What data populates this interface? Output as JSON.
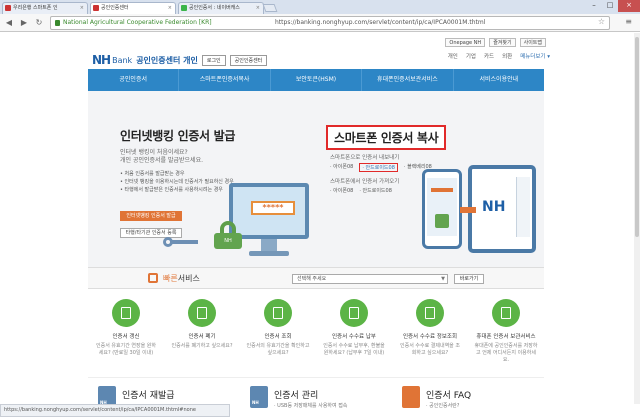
{
  "browser": {
    "tabs": [
      {
        "label": "우리은행 스마트폰 인",
        "active": false
      },
      {
        "label": "공인인증센터",
        "active": true
      },
      {
        "label": "공인인증서 : 네이버캐스",
        "active": false
      }
    ],
    "ev_label": "National Agricultural Cooperative Federation [KR]",
    "url": "https://banking.nonghyup.com/servlet/content/ip/ca/IPCA0001M.thtml",
    "status_url": "https://banking.nonghyup.com/servlet/content/ip/ca/IPCA0001M.thtml#none"
  },
  "header": {
    "logo_nh": "NH",
    "logo_bank": "Bank",
    "logo_title": "공인인증센터 개인",
    "login_btn": "로그인",
    "center_btn": "공인인증센터",
    "onepage": "Onepage NH",
    "favorites": "즐겨찾기",
    "sitemap": "사이트맵",
    "subnav": [
      "개인",
      "기업",
      "카드",
      "외환",
      "메뉴더보기 ▾"
    ]
  },
  "gnb": [
    "공인인증서",
    "스마트폰인증서복사",
    "보안토큰(HSM)",
    "휴대폰인증서보관서비스",
    "서비스이용안내"
  ],
  "left_panel": {
    "title": "인터넷뱅킹 인증서 발급",
    "desc1": "인터넷 뱅킹이 처음이세요?",
    "desc2": "개인 공인인증서를 발급받으세요.",
    "bullets": [
      "• 처음 인증서를 발급받는 경우",
      "• 인터넷 뱅킹을 이용하시는데 인증서가 필요하신 경우",
      "• 타행에서 발급받은 인증서를 사용하시려는 경우"
    ],
    "issue_btn": "인터넷뱅킹 인증서 발급",
    "register_btn": "타행/타기관 인증서 등록",
    "password_mask": "*****",
    "lock_label": "NH"
  },
  "right_panel": {
    "title": "스마트폰 인증서 복사",
    "export_title": "스마트폰으로 인증서 내보내기",
    "export_links": [
      "· 아이폰08",
      "· 안드로이드08",
      "· 블랙베리08"
    ],
    "import_title": "스마트폰에서 인증서 가져오기",
    "import_links": [
      "· 아이폰08",
      "· 안드로이드08"
    ],
    "tablet_logo": "NH"
  },
  "quick": {
    "label_prefix": "빠른",
    "label_suffix": "서비스",
    "select_placeholder": "선택해 주세요",
    "go_btn": "바로가기"
  },
  "services": [
    {
      "name": "인증서 갱신",
      "desc": "인증서 유효기간 연장을 원하세요? (만료일 30일 이내)"
    },
    {
      "name": "인증서 폐기",
      "desc": "인증서를 폐기하고 싶으세요?"
    },
    {
      "name": "인증서 조회",
      "desc": "인증서의 유효기간을 확인하고 싶으세요?"
    },
    {
      "name": "인증서 수수료 납부",
      "desc": "인증서 수수료 납부후, 환불을 원하세요? (납부후 7일 이내)"
    },
    {
      "name": "인증서 수수료 정보조회",
      "desc": "인증서 수수료 결제내역을 조회하고 싶으세요?"
    },
    {
      "name": "휴대폰 인증서 보관서비스",
      "desc": "휴대폰에 공인인증서를 저장하고 언제 어디서든지 이용하세요."
    }
  ],
  "bottom": [
    {
      "title": "인증서 재발급",
      "sub": "",
      "icon": "NH"
    },
    {
      "title": "인증서 관리",
      "sub": "· USB등 저장매체를 사용하여 접속",
      "icon": "NH"
    },
    {
      "title": "인증서 FAQ",
      "sub": "· 공인인증서란?",
      "icon": "NH"
    }
  ],
  "colors": {
    "accent_blue": "#2d86c6",
    "orange": "#e07436",
    "green": "#5cb446",
    "highlight_red": "#e12a2a"
  }
}
